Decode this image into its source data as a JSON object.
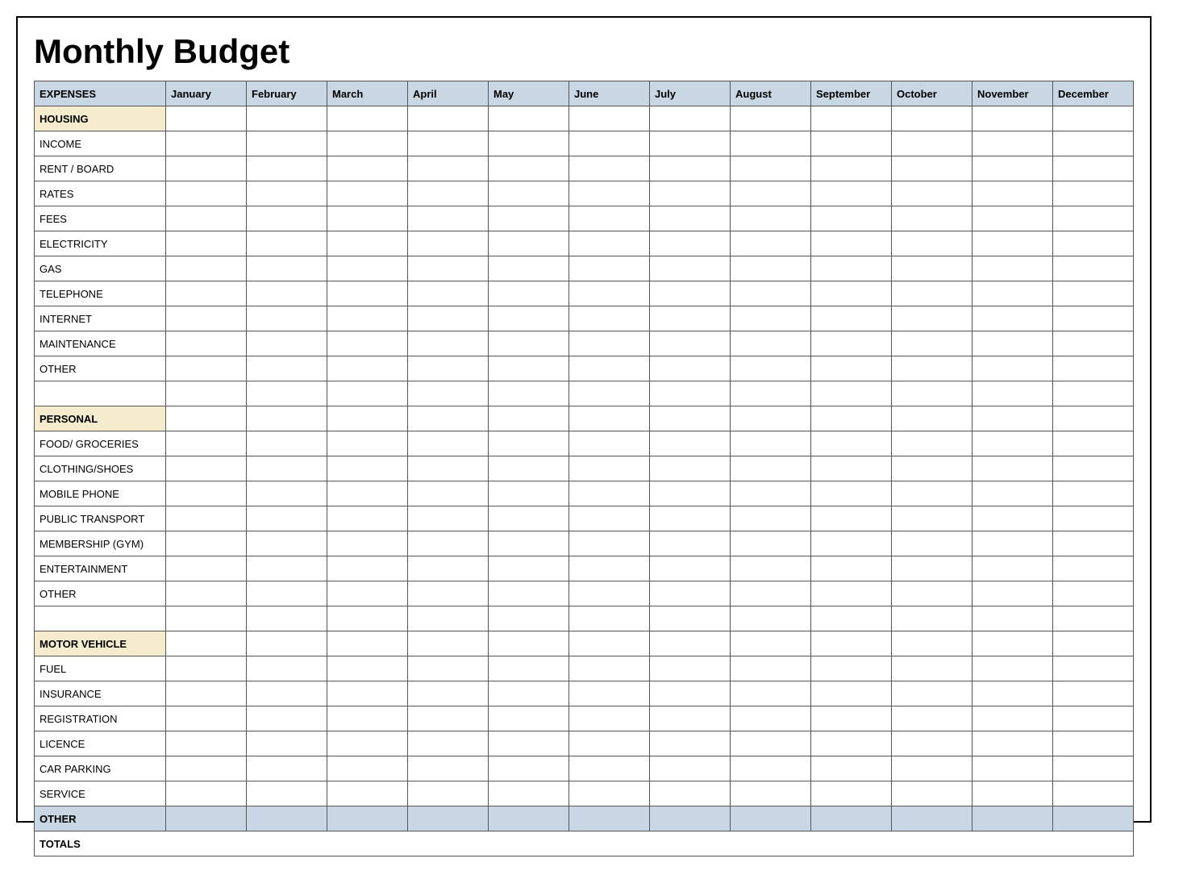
{
  "title": "Monthly Budget",
  "header_label": "EXPENSES",
  "months": [
    "January",
    "February",
    "March",
    "April",
    "May",
    "June",
    "July",
    "August",
    "September",
    "October",
    "November",
    "December"
  ],
  "sections": [
    {
      "name": "HOUSING",
      "items": [
        "INCOME",
        "RENT / BOARD",
        "RATES",
        "FEES",
        "ELECTRICITY",
        "GAS",
        "TELEPHONE",
        "INTERNET",
        "MAINTENANCE",
        "OTHER"
      ],
      "blank_after": true
    },
    {
      "name": "PERSONAL",
      "items": [
        "FOOD/ GROCERIES",
        "CLOTHING/SHOES",
        "MOBILE PHONE",
        "PUBLIC TRANSPORT",
        "MEMBERSHIP (GYM)",
        "ENTERTAINMENT",
        "OTHER"
      ],
      "blank_after": true
    },
    {
      "name": "MOTOR VEHICLE",
      "items": [
        "FUEL",
        "INSURANCE",
        "REGISTRATION",
        "LICENCE",
        "CAR PARKING",
        "SERVICE"
      ],
      "blank_after": false
    }
  ],
  "other_label": "OTHER",
  "totals_label": "TOTALS"
}
